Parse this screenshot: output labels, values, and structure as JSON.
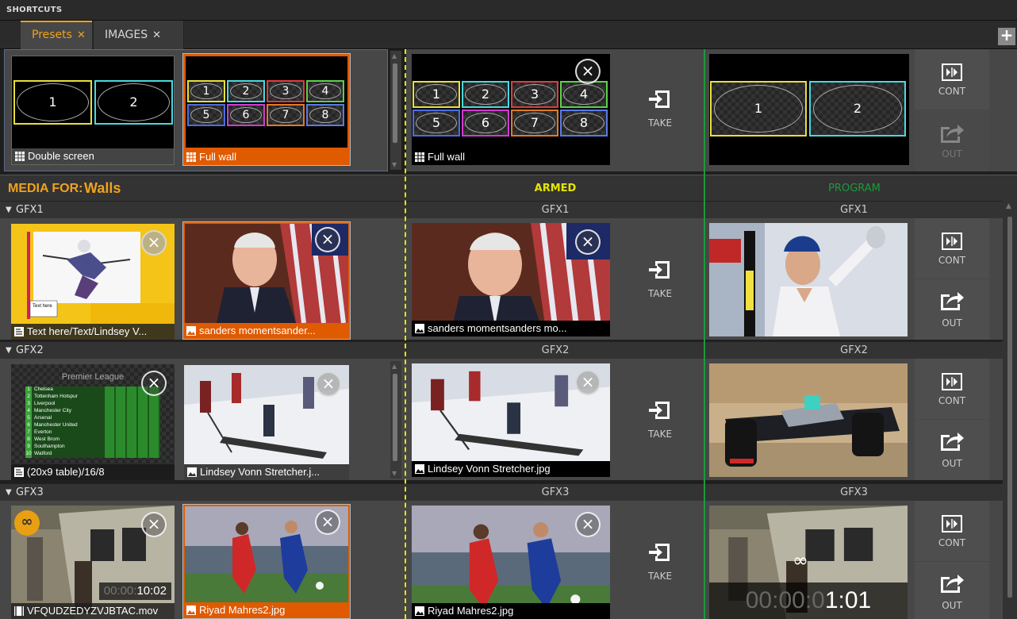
{
  "shortcuts": {
    "title": "SHORTCUTS"
  },
  "tabs": [
    {
      "label": "Presets",
      "close": "✕"
    },
    {
      "label": "IMAGES",
      "close": "✕"
    }
  ],
  "add_tab": "+",
  "presets": {
    "items": [
      {
        "label": "Double screen",
        "slots": [
          "1",
          "2"
        ]
      },
      {
        "label": "Full wall",
        "slots": [
          "1",
          "2",
          "3",
          "4",
          "5",
          "6",
          "7",
          "8"
        ]
      }
    ],
    "armed": {
      "label": "Full wall",
      "slots": [
        "1",
        "2",
        "3",
        "4",
        "5",
        "6",
        "7",
        "8"
      ]
    },
    "program": {
      "slots": [
        "1",
        "2"
      ]
    }
  },
  "media_for": {
    "prefix": "MEDIA FOR:",
    "name": "Walls"
  },
  "columns": {
    "armed": "ARMED",
    "program": "PROGRAM"
  },
  "buttons": {
    "take": "TAKE",
    "cont": "CONT",
    "out": "OUT"
  },
  "groups": [
    {
      "name": "GFX1",
      "items": [
        {
          "label": "Text here/Text/Lindsey V...",
          "type": "text"
        },
        {
          "label": "sanders momentsander...",
          "type": "image",
          "selected": true
        }
      ],
      "armed": {
        "label": "sanders momentsanders mo..."
      },
      "program": {}
    },
    {
      "name": "GFX2",
      "items": [
        {
          "label": "(20x9 table)/16/8",
          "type": "text",
          "table_title": "Premier League",
          "teams": [
            "Chelsea",
            "Tottenham Hotspur",
            "Liverpool",
            "Manchester City",
            "Arsenal",
            "Manchester United",
            "Everton",
            "West Brom",
            "Southampton",
            "Watford"
          ]
        },
        {
          "label": "Lindsey Vonn Stretcher.j...",
          "type": "image"
        }
      ],
      "armed": {
        "label": "Lindsey Vonn Stretcher.jpg"
      },
      "program": {}
    },
    {
      "name": "GFX3",
      "items": [
        {
          "label": "VFQUDZEDYZVJBTAC.mov",
          "type": "video",
          "loop": "∞",
          "timecode_dim": "00:00:",
          "timecode": "10:02"
        },
        {
          "label": "Riyad Mahres2.jpg",
          "type": "image",
          "selected": true
        }
      ],
      "armed": {
        "label": "Riyad Mahres2.jpg"
      },
      "program": {
        "loop": "∞",
        "timecode_dim": "00:00:0",
        "timecode": "1:01"
      }
    }
  ],
  "close_glyph": "×",
  "colors": {
    "accent": "#f0a21d",
    "armed": "#e5e500",
    "program": "#1c9a3c",
    "selected": "#e05a00"
  }
}
